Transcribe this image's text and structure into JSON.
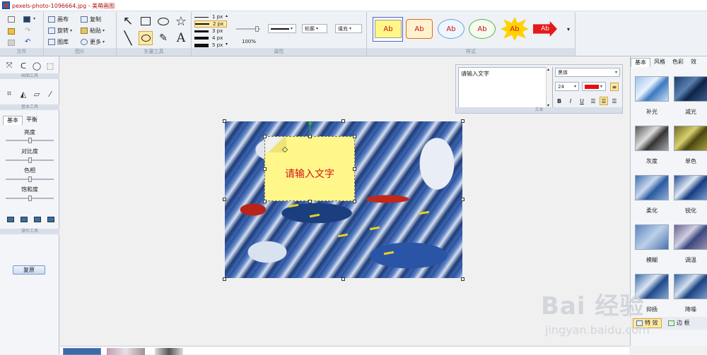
{
  "window": {
    "title": "pexels-photo-1096664.jpg - 美萌画图"
  },
  "ribbon": {
    "file": {
      "label": "文件"
    },
    "picture": {
      "label": "图片",
      "items": {
        "canvas": "画布",
        "rotate": "旋转",
        "gallery": "图库",
        "copy": "复制",
        "paste": "粘贴",
        "more": "更多"
      }
    },
    "tools": {
      "label": "矢量工具",
      "text_glyph": "A"
    },
    "props": {
      "label": "属性",
      "line_widths": [
        "1 px",
        "2 px",
        "3 px",
        "4 px",
        "5 px"
      ],
      "selected_width": "2 px",
      "zoom": "100%",
      "outline": "轮廓",
      "fill": "填充"
    },
    "styles": {
      "label": "样式",
      "bubble_text": "Ab"
    }
  },
  "left_panel": {
    "section1": "画图工具",
    "section2": "基本工具",
    "tabs": [
      "基本",
      "平衡"
    ],
    "adjustments": [
      "亮度",
      "对比度",
      "色相",
      "饱和度"
    ],
    "section3": "操作工具",
    "reset": "复原"
  },
  "note": {
    "text": "请输入文字"
  },
  "text_panel": {
    "content": "请输入文字",
    "font": "黑体",
    "size": "24",
    "color": "#e01010",
    "label": "文本"
  },
  "right_panel": {
    "tabs": [
      "基本",
      "风格",
      "色彩",
      "效"
    ],
    "effects": [
      "补光",
      "减光",
      "灰度",
      "单色",
      "柔化",
      "锐化",
      "模糊",
      "调温",
      "抑扬",
      "降噪"
    ],
    "bottom": {
      "effects": "特 效",
      "frame": "边 框"
    }
  },
  "watermark": {
    "brand": "Bai  经验",
    "url": "jingyan.baidu.com"
  }
}
